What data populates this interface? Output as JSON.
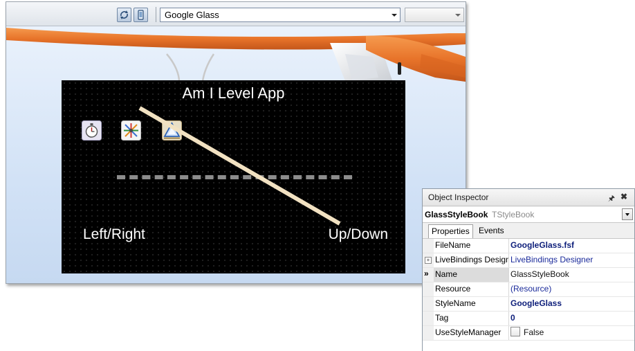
{
  "designer": {
    "toolbar": {
      "device_combo_value": "Google Glass",
      "second_combo_value": ""
    },
    "app": {
      "title": "Am I Level App",
      "left_label": "Left/Right",
      "right_label": "Up/Down",
      "icons": [
        "stopwatch-icon",
        "accelerometer-icon",
        "inclinometer-icon"
      ]
    },
    "colors": {
      "frame_orange": "#e8742a",
      "screen_bg": "#000000",
      "tilt_line": "#f2e2c2",
      "level_dash": "#8c8c8c"
    }
  },
  "inspector": {
    "title": "Object Inspector",
    "selected_name": "GlassStyleBook",
    "selected_type": "TStyleBook",
    "tabs": [
      "Properties",
      "Events"
    ],
    "rows": [
      {
        "prop": "FileName",
        "value": "GoogleGlass.fsf",
        "style": "bold"
      },
      {
        "prop": "LiveBindings Designer",
        "value": "LiveBindings Designer",
        "style": "link"
      },
      {
        "prop": "Name",
        "value": "GlassStyleBook",
        "style": "plain"
      },
      {
        "prop": "Resource",
        "value": "(Resource)",
        "style": "link"
      },
      {
        "prop": "StyleName",
        "value": "GoogleGlass",
        "style": "bold"
      },
      {
        "prop": "Tag",
        "value": "0",
        "style": "num"
      },
      {
        "prop": "UseStyleManager",
        "value": "False",
        "style": "plain"
      }
    ]
  }
}
